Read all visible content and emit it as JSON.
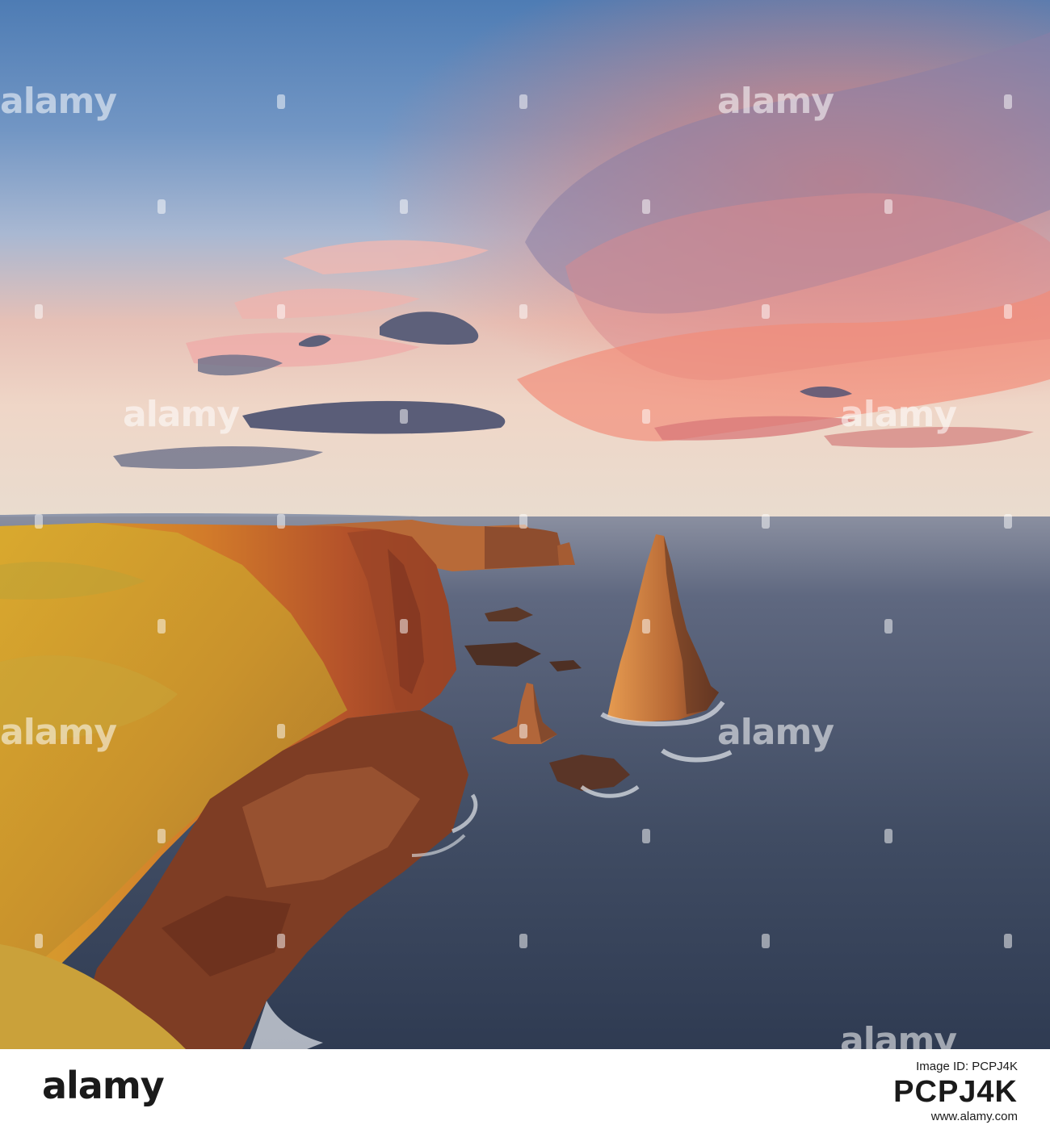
{
  "watermark": {
    "text": "alamy"
  },
  "footer": {
    "logo": "alamy",
    "image_id_label": "Image ID: PCPJ4K",
    "image_id": "PCPJ4K",
    "url": "www.alamy.com"
  },
  "colors": {
    "sky_top": "#5b86b8",
    "sunset_pink": "#f0857a",
    "sea": "#4a566a",
    "cliff_orange": "#d9782a",
    "grass_gold": "#d8a02a"
  }
}
